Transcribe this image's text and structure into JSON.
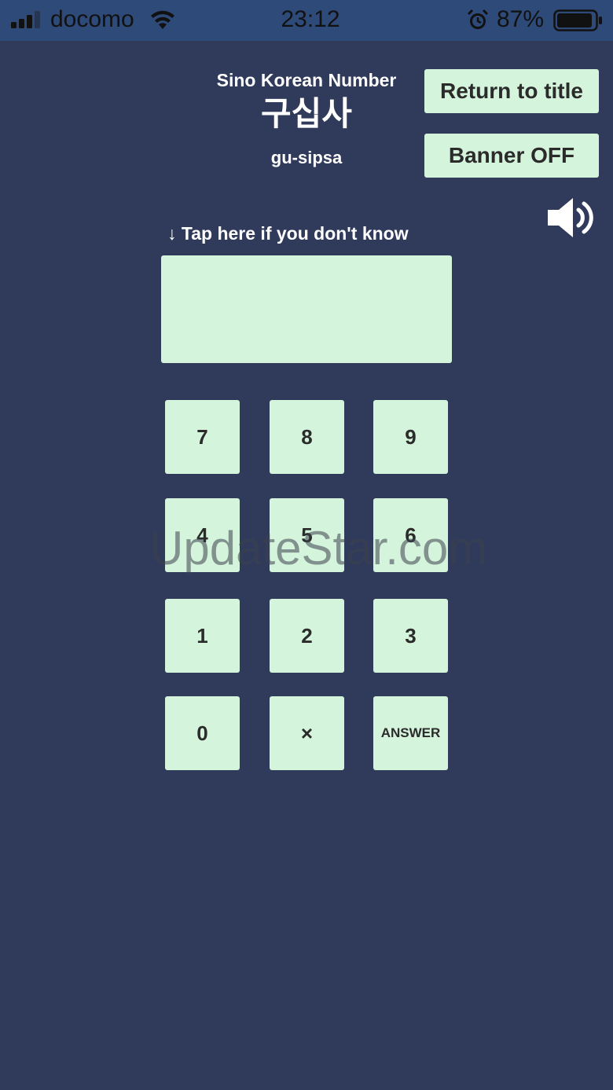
{
  "status_bar": {
    "carrier": "docomo",
    "time": "23:12",
    "battery_percent": "87%",
    "icons": [
      "signal-icon",
      "wifi-icon",
      "alarm-icon",
      "battery-icon"
    ]
  },
  "header": {
    "mode_label": "Sino Korean Number",
    "korean_word": "구십사",
    "romanization": "gu-sipsa"
  },
  "buttons": {
    "return_to_title": "Return to title",
    "banner_toggle": "Banner OFF"
  },
  "sound": {
    "icon": "speaker-icon"
  },
  "hint": {
    "text": "↓ Tap here if you don't know"
  },
  "answer": {
    "value": ""
  },
  "keypad": {
    "keys": [
      "7",
      "8",
      "9",
      "4",
      "5",
      "6",
      "1",
      "2",
      "3",
      "0",
      "×",
      "ANSWER"
    ]
  },
  "watermark": {
    "text": "UpdateStar.com"
  },
  "colors": {
    "background": "#303a5b",
    "status_bar": "#2e4a78",
    "button": "#d5f4dc",
    "button_text": "#2b2b2b",
    "label_text": "#ffffff"
  }
}
